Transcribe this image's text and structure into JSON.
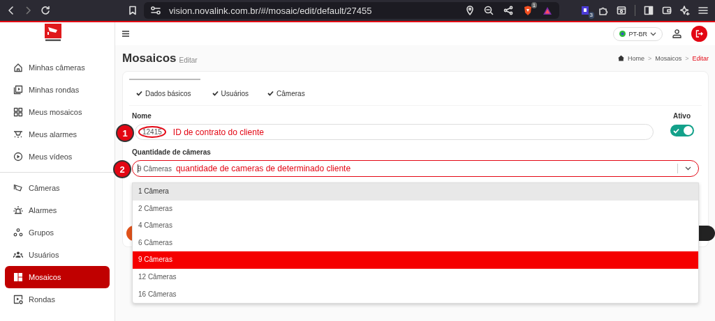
{
  "browser": {
    "url": "vision.novalink.com.br/#/mosaic/edit/default/27455",
    "shield_badge": "1",
    "extension_badge": "3"
  },
  "sidebar": {
    "groups": [
      {
        "items": [
          {
            "label": "Minhas câmeras",
            "selected": false
          },
          {
            "label": "Minhas rondas",
            "selected": false
          },
          {
            "label": "Meus mosaicos",
            "selected": false
          },
          {
            "label": "Meus alarmes",
            "selected": false
          },
          {
            "label": "Meus vídeos",
            "selected": false
          }
        ]
      },
      {
        "items": [
          {
            "label": "Câmeras",
            "selected": false
          },
          {
            "label": "Alarmes",
            "selected": false
          },
          {
            "label": "Grupos",
            "selected": false
          },
          {
            "label": "Usuários",
            "selected": false
          },
          {
            "label": "Mosaicos",
            "selected": true
          },
          {
            "label": "Rondas",
            "selected": false
          }
        ]
      }
    ]
  },
  "header": {
    "language": "PT-BR"
  },
  "page": {
    "title": "Mosaicos",
    "subtitle": "Editar",
    "separator": ">",
    "breadcrumb": [
      {
        "label": "Home",
        "current": false
      },
      {
        "label": "Mosaicos",
        "current": false
      },
      {
        "label": "Editar",
        "current": true
      }
    ]
  },
  "tabs": [
    {
      "label": "Dados básicos",
      "selected": true
    },
    {
      "label": "Usuários",
      "selected": false
    },
    {
      "label": "Câmeras",
      "selected": false
    }
  ],
  "form": {
    "name_label": "Nome",
    "name_value": "12415",
    "active_label": "Ativo",
    "active_on": true,
    "count_label": "Quantidade de câmeras",
    "count_value": "9 Câmeras",
    "dropdown_open": true
  },
  "dropdown": {
    "options": [
      {
        "label": "1 Câmera",
        "highlighted": true,
        "selected": false
      },
      {
        "label": "2 Câmeras",
        "highlighted": false,
        "selected": false
      },
      {
        "label": "4 Câmeras",
        "highlighted": false,
        "selected": false
      },
      {
        "label": "6 Câmeras",
        "highlighted": false,
        "selected": false
      },
      {
        "label": "9 Câmeras",
        "highlighted": false,
        "selected": true
      },
      {
        "label": "12 Câmeras",
        "highlighted": false,
        "selected": false
      },
      {
        "label": "16 Câmeras",
        "highlighted": false,
        "selected": false
      }
    ]
  },
  "annotations": [
    {
      "number": "1",
      "text": "ID de contrato do cliente"
    },
    {
      "number": "2",
      "text": "quantidade de cameras de determinado cliente"
    }
  ]
}
